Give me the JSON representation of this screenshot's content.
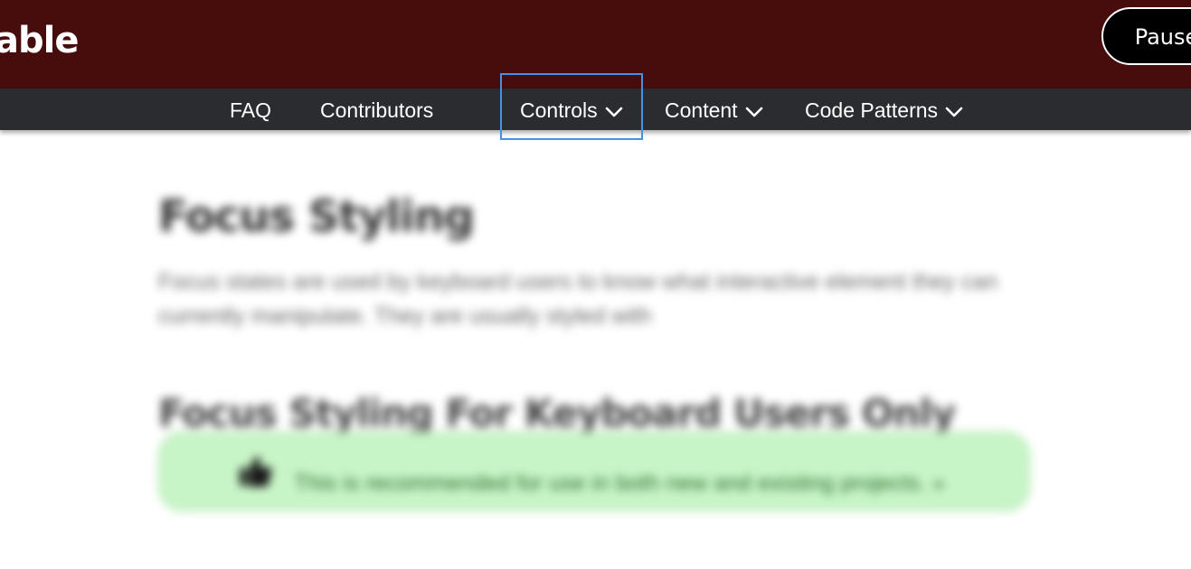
{
  "brand": {
    "logo_text": "able",
    "pause_label": "Pause"
  },
  "nav": {
    "items": [
      {
        "label": "FAQ",
        "has_dropdown": false
      },
      {
        "label": "Contributors",
        "has_dropdown": false
      },
      {
        "label": "Controls",
        "has_dropdown": true,
        "focused": true
      },
      {
        "label": "Content",
        "has_dropdown": true
      },
      {
        "label": "Code Patterns",
        "has_dropdown": true
      }
    ]
  },
  "content": {
    "page_title": "Focus Styling",
    "intro": "Focus states are used by keyboard users to know what interactive element they can currently manipulate. They are usually styled with",
    "section_title": "Focus Styling For Keyboard Users Only",
    "callout": {
      "icon": "thumbs-up-icon",
      "text": "This is recommended for use in both new and existing projects. »"
    }
  },
  "colors": {
    "brand_bar": "#470c0c",
    "nav_bar": "#2b2c30",
    "focus_ring": "#4a90e2",
    "callout_bg": "#c8f5c8"
  }
}
